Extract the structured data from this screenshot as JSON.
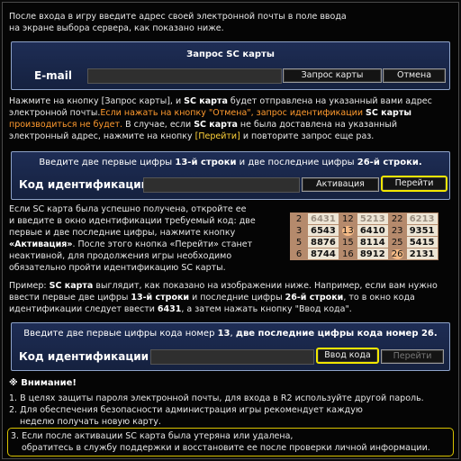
{
  "intro": {
    "line1": "После входа в игру введите адрес своей электронной почты в поле ввода",
    "line2": "на экране выбора сервера, как показано ниже."
  },
  "panel1": {
    "title": "Запрос SC карты",
    "email_label": "E-mail",
    "request_button": "Запрос карты",
    "cancel_button": "Отмена"
  },
  "para2": {
    "l1a": "Нажмите на кнопку [Запрос карты], и ",
    "l1b": "SC карта",
    "l1c": " будет отправлена на указанный вами адрес",
    "l2a": "электронной почты.",
    "l2b": "Если нажать на кнопку \"Отмена\", запрос идентификации ",
    "l2c": "SC карты",
    "l3": "производиться не будет.",
    "l3b": " В случае, если ",
    "l3c": "SC карта",
    "l3d": " не была доставлена на указанный",
    "l4a": "электронный адрес, нажмите на кнопку ",
    "l4b": "[Перейти]",
    "l4c": " и повторите запрос еще раз."
  },
  "panel2": {
    "title_a": "Введите две первые цифры ",
    "title_b": "13-й строки",
    "title_c": " и две последние цифры ",
    "title_d": "26-й строки.",
    "id_label": "Код идентификации",
    "activate_button": "Активация",
    "go_button": "Перейти"
  },
  "para3": {
    "l1": "Если SC карта была успешно получена, откройте ее",
    "l2": "и введите в окно идентификации требуемый код: две",
    "l3": "первые и две последние цифры, нажмите кнопку",
    "l4a": "«Активация»",
    "l4b": ". После этого кнопка «Перейти» станет",
    "l5": "неактивной, для продолжения игры необходимо",
    "l6": "обязательно пройти идентификацию SC карты."
  },
  "sc_card": {
    "rows": [
      {
        "n": "2",
        "c": [
          "6431",
          "12",
          "5213",
          "22",
          "6213"
        ]
      },
      {
        "n": "3",
        "c": [
          "6543",
          "13",
          "6410",
          "23",
          "9351"
        ]
      },
      {
        "n": "5",
        "c": [
          "8876",
          "15",
          "8114",
          "25",
          "5415"
        ]
      },
      {
        "n": "6",
        "c": [
          "8744",
          "16",
          "8912",
          "26",
          "2131"
        ]
      }
    ]
  },
  "para4": {
    "l1a": "Пример: ",
    "l1b": "SC карта",
    "l1c": " выглядит, как показано на изображении ниже. Например, если вам нужно",
    "l2a": "ввести первые две цифры ",
    "l2b": "13-й строки",
    "l2c": " и последние цифры ",
    "l2d": "26-й строки",
    "l2e": ", то в окно кода",
    "l3a": "идентификации следует ввести ",
    "l3b": "6431",
    "l3c": ", а затем нажать кнопку \"Ввод кода\"."
  },
  "panel3": {
    "title_a": "Введите две первые цифры кода номер ",
    "title_b": "13",
    "title_c": ", ",
    "title_d": "две последние цифры кода номер 26.",
    "id_label": "Код идентификации",
    "enter_button": "Ввод кода",
    "go_button": "Перейти"
  },
  "warning": {
    "title": "※ Внимание!",
    "i1": "1. В целях защиты пароля электронной почты, для входа в R2 используйте другой пароль.",
    "i2a": "2. Для обеспечения безопасности администрация игры рекомендует каждую",
    "i2b": "неделю получать новую карту.",
    "i3a": "3. Если после активации SC карта была утеряна или удалена,",
    "i3b": "обратитесь в службу поддержки и восстановите ее после проверки личной информации."
  }
}
